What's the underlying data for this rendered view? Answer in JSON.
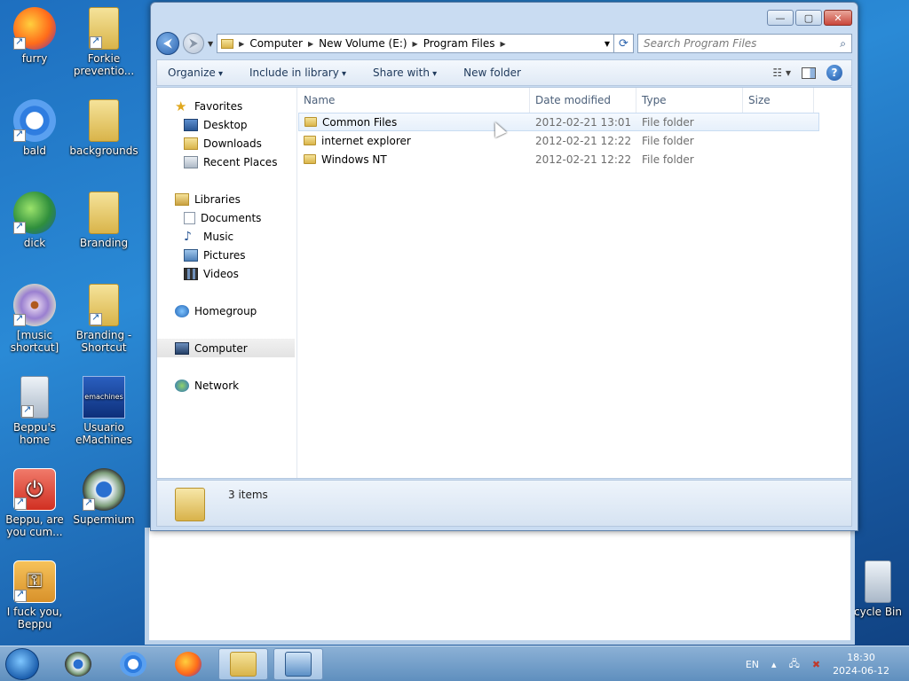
{
  "desktop": {
    "icons": [
      {
        "label": "furry",
        "name": "firefox-shortcut"
      },
      {
        "label": "Forkie preventio...",
        "name": "forkie-folder-shortcut"
      },
      {
        "label": "bald",
        "name": "chrome-shortcut"
      },
      {
        "label": "backgrounds",
        "name": "backgrounds-folder"
      },
      {
        "label": "dick",
        "name": "download-manager-shortcut"
      },
      {
        "label": "Branding",
        "name": "branding-folder"
      },
      {
        "label": "[music shortcut]",
        "name": "media-player-shortcut"
      },
      {
        "label": "Branding - Shortcut",
        "name": "branding-shortcut"
      },
      {
        "label": "Beppu's home",
        "name": "beppu-home-shortcut"
      },
      {
        "label": "Usuario eMachines",
        "name": "emachines-user"
      },
      {
        "label": "Beppu, are you cum...",
        "name": "beppu-shutdown-shortcut"
      },
      {
        "label": "Supermium",
        "name": "supermium-shortcut"
      },
      {
        "label": "I fuck you, Beppu",
        "name": "key-shortcut"
      },
      {
        "label": "cycle Bin",
        "name": "recycle-bin"
      }
    ],
    "emachines_tile": "emachines"
  },
  "window": {
    "buttons": {
      "minimize": "—",
      "maximize": "▢",
      "close": "✕"
    },
    "address": {
      "crumbs": [
        "Computer",
        "New Volume (E:)",
        "Program Files"
      ]
    },
    "search": {
      "placeholder": "Search Program Files"
    },
    "toolbar": {
      "organize": "Organize",
      "include": "Include in library",
      "share": "Share with",
      "newfolder": "New folder"
    },
    "nav": {
      "favorites": "Favorites",
      "desktop": "Desktop",
      "downloads": "Downloads",
      "recent": "Recent Places",
      "libraries": "Libraries",
      "documents": "Documents",
      "music": "Music",
      "pictures": "Pictures",
      "videos": "Videos",
      "homegroup": "Homegroup",
      "computer": "Computer",
      "network": "Network"
    },
    "columns": {
      "name": "Name",
      "date": "Date modified",
      "type": "Type",
      "size": "Size"
    },
    "files": [
      {
        "name": "Common Files",
        "date": "2012-02-21 13:01",
        "type": "File folder"
      },
      {
        "name": "internet explorer",
        "date": "2012-02-21 12:22",
        "type": "File folder"
      },
      {
        "name": "Windows NT",
        "date": "2012-02-21 12:22",
        "type": "File folder"
      }
    ],
    "details": {
      "count": "3 items"
    }
  },
  "taskbar": {
    "lang": "EN",
    "time": "18:30",
    "date": "2024-06-12"
  },
  "colors": {
    "accent": "#2b63ae",
    "taskbar": "#7aa3cc"
  }
}
